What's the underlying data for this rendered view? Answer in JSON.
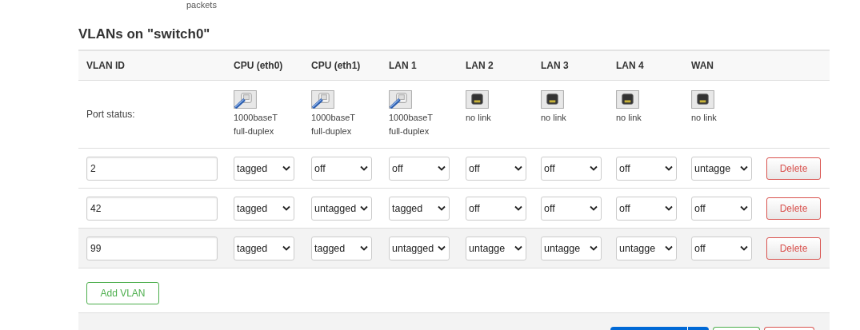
{
  "above_text": "packets",
  "section_title": "VLANs on \"switch0\"",
  "table": {
    "columns": [
      "VLAN ID",
      "CPU (eth0)",
      "CPU (eth1)",
      "LAN 1",
      "LAN 2",
      "LAN 3",
      "LAN 4",
      "WAN"
    ],
    "port_status": {
      "label": "Port status:",
      "ports": [
        {
          "linked": true,
          "lines": [
            "1000baseT",
            "full-duplex"
          ]
        },
        {
          "linked": true,
          "lines": [
            "1000baseT",
            "full-duplex"
          ]
        },
        {
          "linked": true,
          "lines": [
            "1000baseT",
            "full-duplex"
          ]
        },
        {
          "linked": false,
          "lines": [
            "no link"
          ]
        },
        {
          "linked": false,
          "lines": [
            "no link"
          ]
        },
        {
          "linked": false,
          "lines": [
            "no link"
          ]
        },
        {
          "linked": false,
          "lines": [
            "no link"
          ]
        }
      ]
    },
    "rows": [
      {
        "vlan_id": "2",
        "ports": [
          "tagged",
          "off",
          "off",
          "off",
          "off",
          "off",
          "untagge"
        ],
        "delete": "Delete",
        "highlighted": false
      },
      {
        "vlan_id": "42",
        "ports": [
          "tagged",
          "untagged",
          "tagged",
          "off",
          "off",
          "off",
          "off"
        ],
        "delete": "Delete",
        "highlighted": false
      },
      {
        "vlan_id": "99",
        "ports": [
          "tagged",
          "tagged",
          "untagged",
          "untagge",
          "untagge",
          "untagge",
          "off"
        ],
        "delete": "Delete",
        "highlighted": true
      }
    ]
  },
  "add_button": "Add VLAN",
  "footer": {
    "buttons": [
      {
        "kind": "split"
      },
      {
        "kind": "positive"
      },
      {
        "kind": "negative"
      }
    ]
  }
}
